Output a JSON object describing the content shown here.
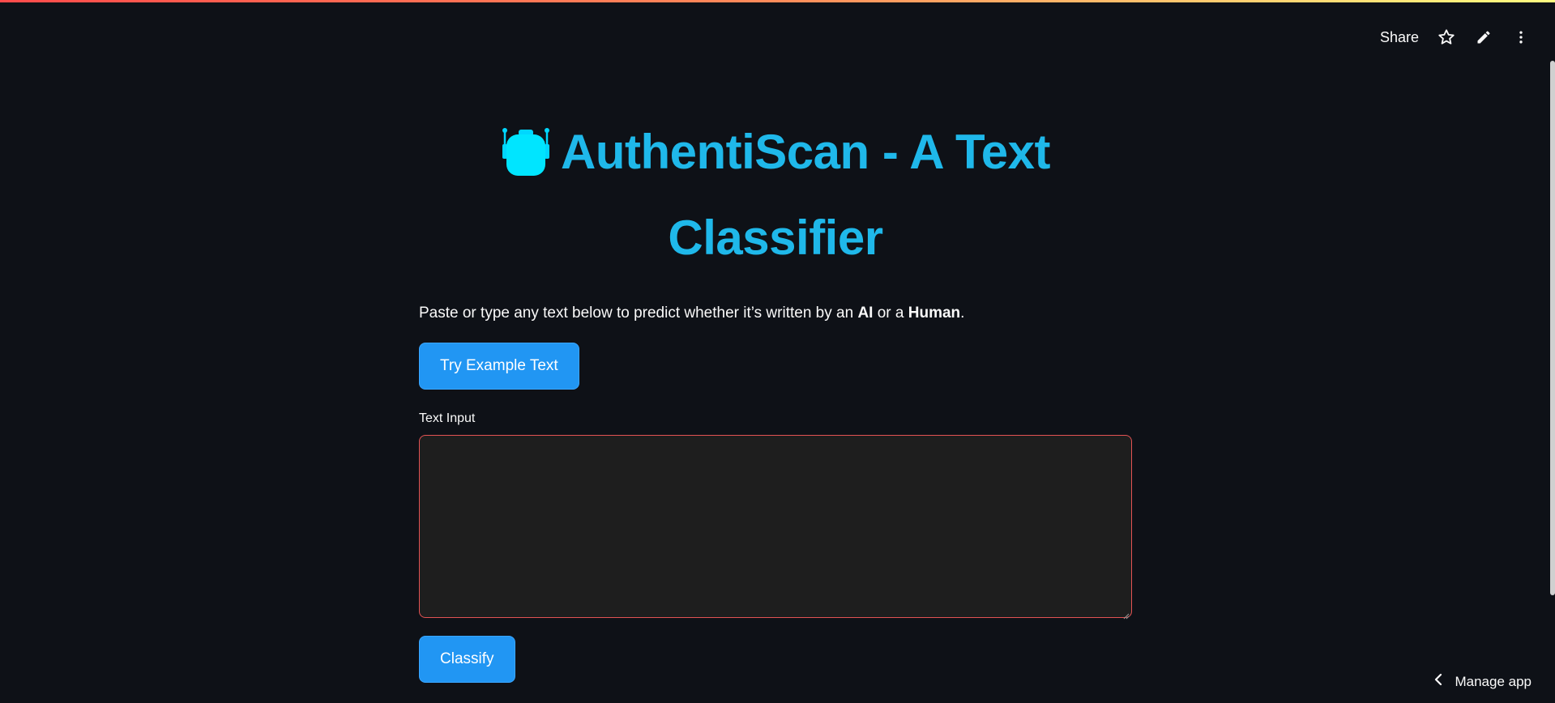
{
  "header": {
    "share_label": "Share",
    "star_icon": "star-icon",
    "edit_icon": "pencil-icon",
    "menu_icon": "more-vertical-icon"
  },
  "main": {
    "title": "AuthentiScan - A Text Classifier",
    "title_icon": "robot-icon",
    "description": {
      "prefix": "Paste or type any text below to predict whether it’s written by an ",
      "bold1": "AI",
      "middle": " or a ",
      "bold2": "Human",
      "suffix": "."
    },
    "example_button_label": "Try Example Text",
    "input_label": "Text Input",
    "input_value": "",
    "classify_button_label": "Classify"
  },
  "footer": {
    "manage_app_label": "Manage app"
  },
  "colors": {
    "accent": "#1fb8ea",
    "button": "#2196f3",
    "background": "#0e1117",
    "input_border": "#e25353"
  }
}
